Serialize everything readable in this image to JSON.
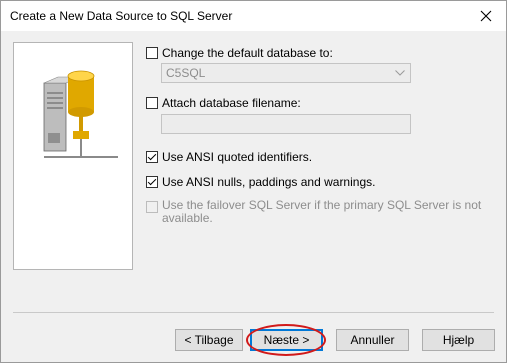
{
  "window": {
    "title": "Create a New Data Source to SQL Server"
  },
  "options": {
    "change_default_db": {
      "label": "Change the default database to:",
      "checked": false
    },
    "database_select": {
      "value": "C5SQL"
    },
    "attach_db_filename": {
      "label": "Attach database filename:",
      "checked": false
    },
    "attach_filename_input": {
      "value": ""
    },
    "ansi_quoted": {
      "label": "Use ANSI quoted identifiers.",
      "checked": true
    },
    "ansi_nulls": {
      "label": "Use ANSI nulls, paddings and warnings.",
      "checked": true
    },
    "failover": {
      "label_line1": "Use the failover SQL Server if the primary SQL Server is not",
      "label_line2": "available.",
      "checked": false,
      "enabled": false
    }
  },
  "buttons": {
    "back": "< Tilbage",
    "next": "Næste >",
    "cancel": "Annuller",
    "help": "Hjælp"
  },
  "colors": {
    "highlight": "#d11a1a",
    "accent": "#0078d7"
  }
}
